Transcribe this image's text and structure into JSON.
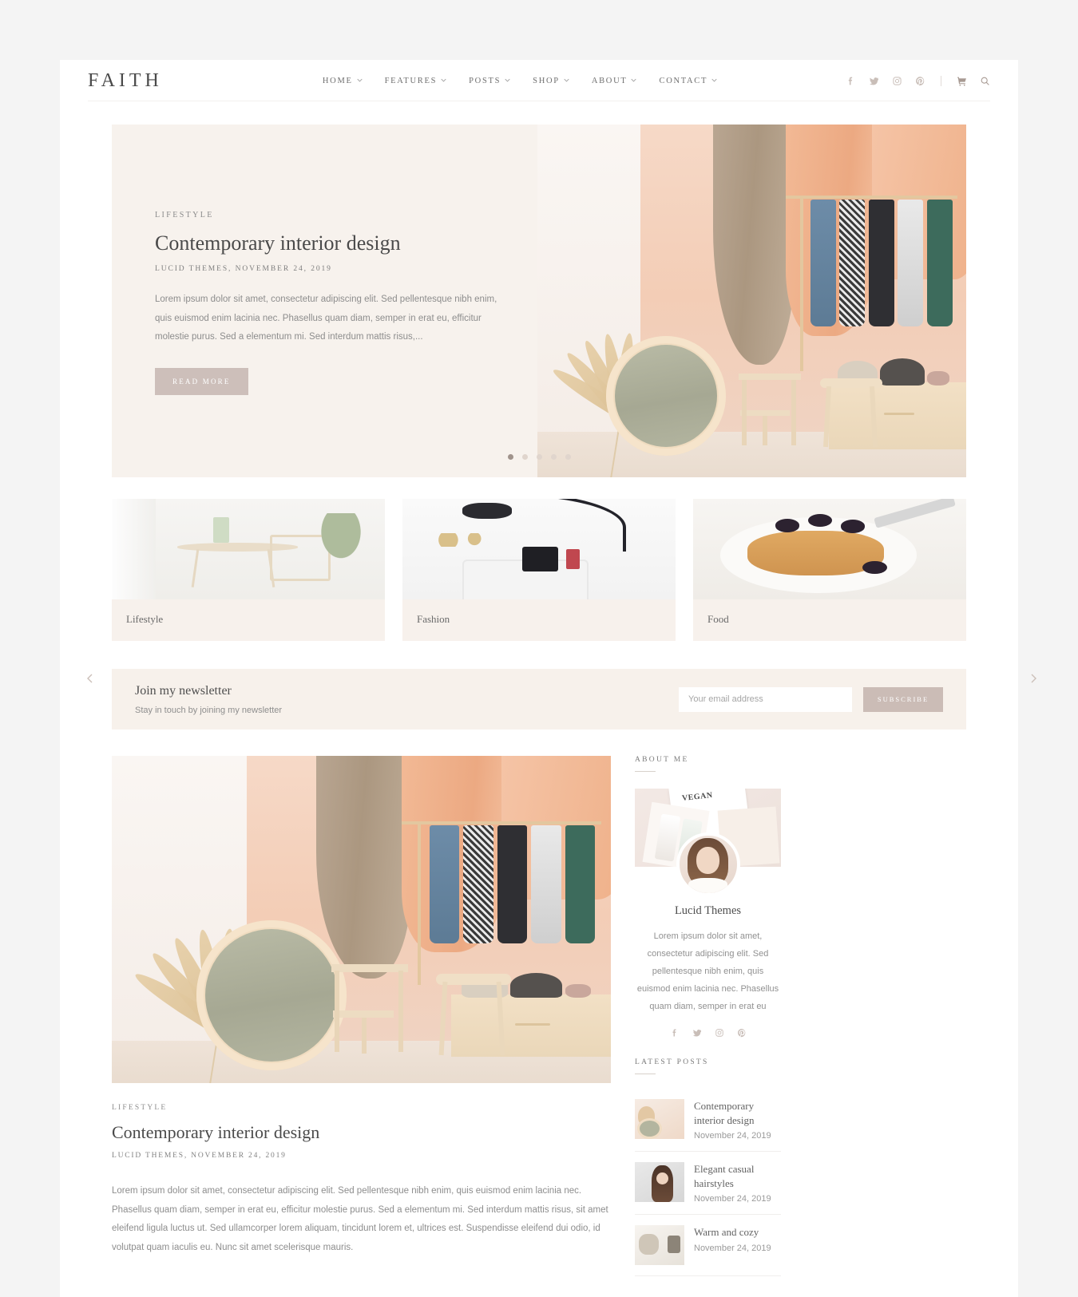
{
  "site": {
    "brand": "FAITH",
    "background_color": "#f4f4f4",
    "accent_color": "#cdbfba",
    "panel_color": "#f7f1eb"
  },
  "nav": {
    "items": [
      {
        "label": "HOME",
        "has_dropdown": true
      },
      {
        "label": "FEATURES",
        "has_dropdown": true
      },
      {
        "label": "POSTS",
        "has_dropdown": true
      },
      {
        "label": "SHOP",
        "has_dropdown": true
      },
      {
        "label": "ABOUT",
        "has_dropdown": true
      },
      {
        "label": "CONTACT",
        "has_dropdown": true
      }
    ],
    "icons": [
      {
        "name": "facebook-icon"
      },
      {
        "name": "twitter-icon"
      },
      {
        "name": "instagram-icon"
      },
      {
        "name": "pinterest-icon"
      },
      {
        "name": "cart-icon"
      },
      {
        "name": "search-icon"
      }
    ]
  },
  "hero": {
    "category": "LIFESTYLE",
    "title": "Contemporary interior design",
    "meta": "LUCID THEMES, NOVEMBER 24, 2019",
    "excerpt": "Lorem ipsum dolor sit amet, consectetur adipiscing elit. Sed pellentesque nibh enim, quis euismod enim lacinia nec. Phasellus quam diam, semper in erat eu, efficitur molestie purus. Sed a elementum mi. Sed interdum mattis risus,...",
    "button_label": "READ MORE",
    "prev_label": "‹",
    "next_label": "›",
    "dot_count": 5,
    "active_dot": 1
  },
  "categories": [
    {
      "label": "Lifestyle"
    },
    {
      "label": "Fashion"
    },
    {
      "label": "Food"
    }
  ],
  "newsletter": {
    "title": "Join my newsletter",
    "subtitle": "Stay in touch by joining my newsletter",
    "input_value": "",
    "input_placeholder": "Your email address",
    "button_label": "SUBSCRIBE"
  },
  "post": {
    "category": "LIFESTYLE",
    "title": "Contemporary interior design",
    "meta": "LUCID THEMES, NOVEMBER 24, 2019",
    "excerpt": "Lorem ipsum dolor sit amet, consectetur adipiscing elit. Sed pellentesque nibh enim, quis euismod enim lacinia nec. Phasellus quam diam, semper in erat eu, efficitur molestie purus. Sed a elementum mi. Sed interdum mattis risus, sit amet eleifend ligula luctus ut. Sed ullamcorper lorem aliquam, tincidunt lorem et, ultrices est. Suspendisse eleifend dui odio, id volutpat quam iaculis eu. Nunc sit amet scelerisque mauris."
  },
  "sidebar": {
    "about": {
      "title": "ABOUT ME",
      "cover_text": "VEGAN",
      "name": "Lucid Themes",
      "text": "Lorem ipsum dolor sit amet, consectetur adipiscing elit. Sed pellentesque nibh enim, quis euismod enim lacinia nec. Phasellus quam diam, semper in erat eu",
      "social": [
        {
          "name": "facebook-icon"
        },
        {
          "name": "twitter-icon"
        },
        {
          "name": "instagram-icon"
        },
        {
          "name": "pinterest-icon"
        }
      ]
    },
    "latest_posts": {
      "title": "LATEST POSTS",
      "items": [
        {
          "title": "Contemporary interior design",
          "date": "November 24, 2019"
        },
        {
          "title": "Elegant casual hairstyles",
          "date": "November 24, 2019"
        },
        {
          "title": "Warm and cozy",
          "date": "November 24, 2019"
        }
      ]
    }
  }
}
